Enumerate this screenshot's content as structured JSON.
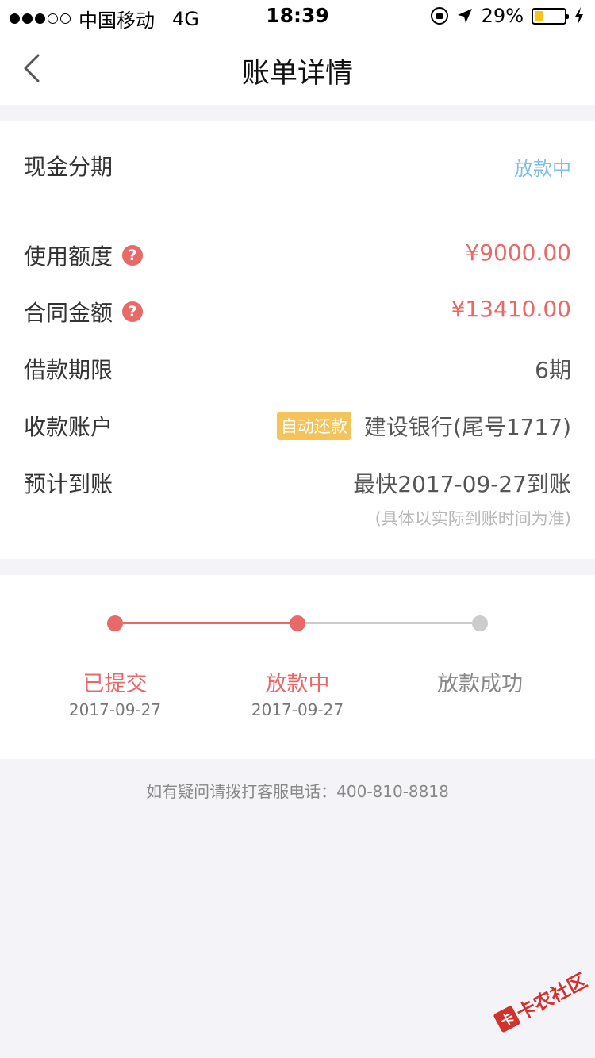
{
  "status_bar": {
    "carrier": "中国移动",
    "network": "4G",
    "time": "18:39",
    "battery_text": "29%",
    "battery_level": 0.29,
    "signal_bars_filled": 3,
    "signal_bars_total": 5
  },
  "nav": {
    "title": "账单详情",
    "back_icon": "chevron-left-icon"
  },
  "product": {
    "name": "现金分期",
    "status": "放款中"
  },
  "details": {
    "quota_label": "使用额度",
    "quota_value": "¥9000.00",
    "contract_label": "合同金额",
    "contract_value": "¥13410.00",
    "term_label": "借款期限",
    "term_value": "6期",
    "account_label": "收款账户",
    "auto_repay_badge": "自动还款",
    "account_value": "建设银行(尾号1717)",
    "arrival_label": "预计到账",
    "arrival_value": "最快2017-09-27到账",
    "arrival_note": "(具体以实际到账时间为准)",
    "help_glyph": "?"
  },
  "progress": {
    "steps": [
      {
        "label": "已提交",
        "date": "2017-09-27",
        "active": true
      },
      {
        "label": "放款中",
        "date": "2017-09-27",
        "active": true
      },
      {
        "label": "放款成功",
        "date": "",
        "active": false
      }
    ],
    "active_color": "#e96868",
    "inactive_color": "#cccccc"
  },
  "footer": {
    "text": "如有疑问请拨打客服电话：400-810-8818"
  },
  "watermark": {
    "logo_glyph": "卡",
    "text": "卡农社区"
  },
  "colors": {
    "accent_red": "#e96868",
    "status_blue": "#7fbfe0",
    "badge_yellow": "#f4c35a",
    "page_bg": "#f4f4f8"
  }
}
